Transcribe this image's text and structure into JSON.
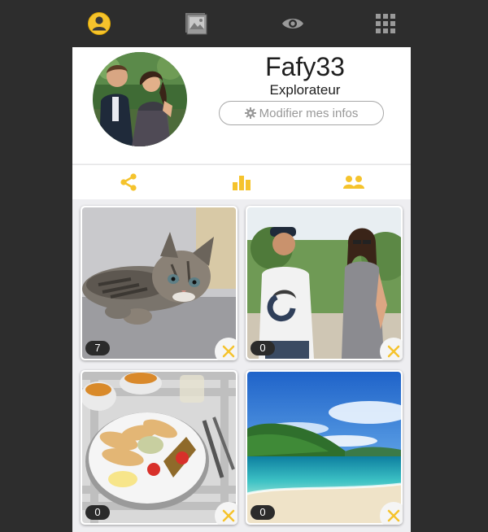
{
  "colors": {
    "accent": "#f5c32c",
    "topbar": "#2d2d2d",
    "icon_gray": "#9a9a9a"
  },
  "topbar": {
    "icons": [
      "profile-icon",
      "gallery-icon",
      "eye-icon",
      "grid-menu-icon"
    ]
  },
  "profile": {
    "username": "Fafy33",
    "rank": "Explorateur",
    "edit_button_label": "Modifier mes infos"
  },
  "tabs": [
    "share-icon",
    "stats-icon",
    "friends-icon"
  ],
  "photos": [
    {
      "subject": "kitten",
      "count": "7"
    },
    {
      "subject": "couple",
      "count": "0"
    },
    {
      "subject": "food-plate",
      "count": "0"
    },
    {
      "subject": "beach",
      "count": "0"
    }
  ]
}
